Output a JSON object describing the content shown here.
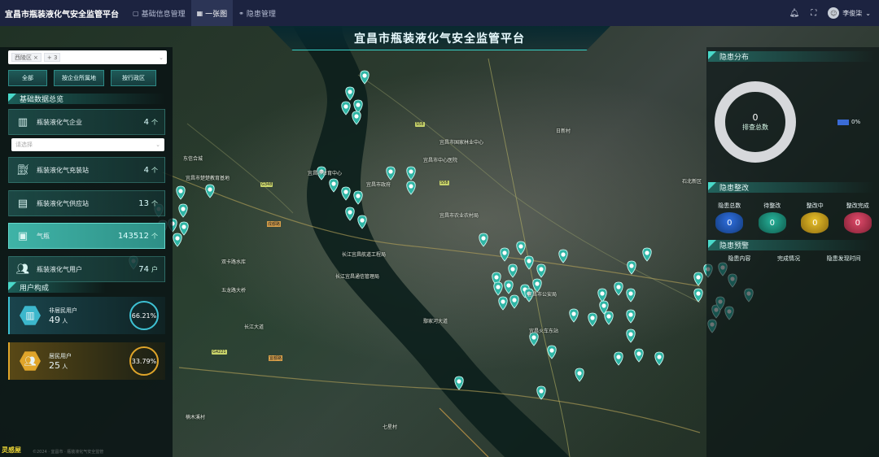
{
  "topbar": {
    "title": "宜昌市瓶装液化气安全监管平台",
    "tabs": [
      {
        "label": "基础信息管理",
        "icon": "file-icon"
      },
      {
        "label": "一张图",
        "icon": "grid-icon"
      },
      {
        "label": "隐患管理",
        "icon": "link-icon"
      }
    ],
    "user": "李俊柒"
  },
  "banner_title": "宜昌市瓶装液化气安全监管平台",
  "left": {
    "filter": {
      "chip": "西陵区",
      "more": "+ 3"
    },
    "buttons": [
      "全部",
      "按企业所属地",
      "按行政区"
    ],
    "overview_title": "基础数据总览",
    "select_placeholder": "请选择",
    "stats": [
      {
        "label": "瓶装液化气企业",
        "value": "4",
        "unit": "个",
        "icon": "building-icon"
      },
      {
        "label": "瓶装液化气充装站",
        "value": "4",
        "unit": "个",
        "icon": "station-icon"
      },
      {
        "label": "瓶装液化气供应站",
        "value": "13",
        "unit": "个",
        "icon": "supply-icon"
      },
      {
        "label": "气瓶",
        "value": "143512",
        "unit": "个",
        "icon": "cylinder-icon"
      },
      {
        "label": "瓶装液化气用户",
        "value": "74",
        "unit": "户",
        "icon": "users-icon"
      }
    ],
    "composition_title": "用户构成",
    "composition": [
      {
        "label": "非居民用户",
        "value": "49",
        "unit": "人",
        "percent": "66.21%"
      },
      {
        "label": "居民用户",
        "value": "25",
        "unit": "人",
        "percent": "33.79%"
      }
    ]
  },
  "right": {
    "distribution_title": "隐患分布",
    "total_value": "0",
    "total_label": "排查总数",
    "legend_percent": "0%",
    "fix_title": "隐患整改",
    "fix_items": [
      {
        "label": "隐患总数",
        "value": "0"
      },
      {
        "label": "待整改",
        "value": "0"
      },
      {
        "label": "整改中",
        "value": "0"
      },
      {
        "label": "整改完成",
        "value": "0"
      }
    ],
    "warning_title": "隐患预警",
    "warning_headers": [
      "隐患内容",
      "完成情况",
      "隐患发现时间"
    ]
  },
  "map_labels": [
    "东信合城",
    "宜昌市楚楚教育基地",
    "宜昌市体育中心",
    "宜昌市政府",
    "宜昌市中心医院",
    "宜昌市农业农村局",
    "长江宜昌航道工程局",
    "长江宜昌通信管理局",
    "宜昌市国家林业中心",
    "宜昌市公安局",
    "双卡路水库",
    "五龙路大桥",
    "鄢家河大道",
    "宜昌火车东站",
    "楠木溪村",
    "七星村",
    "长江大道",
    "日新村",
    "石北新区"
  ],
  "watermark": "灵感屋",
  "footer": "©2024 · 宜昌市 · 瓶装液化气安全监管"
}
